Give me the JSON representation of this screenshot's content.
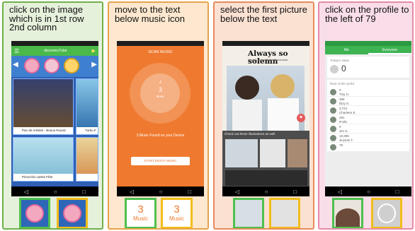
{
  "panels": [
    {
      "instruction": "click on the image which is in 1st row 2nd column",
      "app": {
        "header_text": "discoveryTube",
        "tiles": [
          {
            "caption": "Pan de Artistes - Bonus Round"
          },
          {
            "caption": "Turbo F"
          },
          {
            "caption": "Pinocchio cartes Fête"
          },
          {
            "caption": ""
          }
        ]
      }
    },
    {
      "instruction": "move to the text below music icon",
      "app": {
        "title": "SCAN MUSIC",
        "count": "3",
        "count_label": "Music",
        "found_text": "3 Music Found on your Device",
        "button_label": "START ENJOY MUSIC"
      },
      "options": [
        {
          "number": "3",
          "label": "Music"
        },
        {
          "number": "3",
          "label": "Music"
        }
      ]
    },
    {
      "instruction": "select the first picture below the text",
      "app": {
        "title": "Always so solemn",
        "subtitle": "Sonoya Miyoki © Tojo Sonomana",
        "strip_caption": "Check out these illustrations as well."
      }
    },
    {
      "instruction": "click on the profile to the left of 79",
      "app": {
        "tabs": [
          "Me",
          "Everyone"
        ],
        "today_label": "Today's steps",
        "today_value": "0",
        "rest_label": "Rest of the world",
        "rows": [
          {
            "value": "0",
            "name": "Tiny H."
          },
          {
            "value": "356",
            "name": "Dizy S."
          },
          {
            "value": "3,721",
            "name": "Charleen E."
          },
          {
            "value": "291",
            "name": "IFollo"
          },
          {
            "value": "0",
            "name": "Jim S."
          },
          {
            "value": "10,308",
            "name": "Jiuzemi T."
          },
          {
            "value": "79",
            "name": ""
          }
        ]
      }
    }
  ],
  "nav": {
    "back": "◁",
    "home": "○",
    "recent": "□"
  },
  "colors": {
    "panel1_border": "#6fb04a",
    "panel2_border": "#e8a24a",
    "panel3_border": "#e78a5b",
    "panel4_border": "#e58ba7",
    "option_green": "#4fc04f",
    "option_yellow": "#f2bd1a",
    "music_orange": "#ef7a2f",
    "step_green": "#3db352"
  }
}
